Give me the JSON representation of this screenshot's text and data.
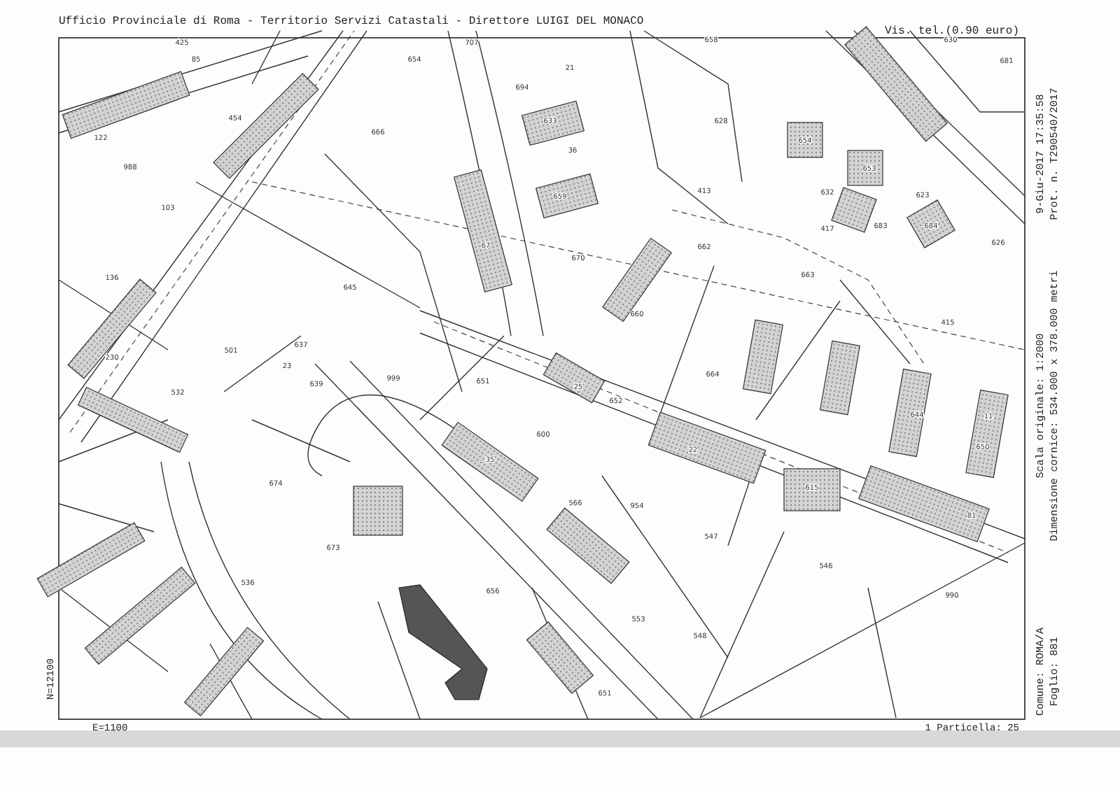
{
  "header": {
    "office": "Ufficio Provinciale di Roma - Territorio Servizi Catastali - Direttore LUIGI DEL MONACO",
    "fee": "Vis. tel.(0.90 euro)"
  },
  "side_info": [
    {
      "lines": [
        "9-Giu-2017 17:35:58",
        "Prot. n. T290540/2017"
      ]
    },
    {
      "lines": [
        "Scala originale: 1:2000",
        "Dimensione cornice: 534.000 x 378.000 metri"
      ]
    },
    {
      "lines": [
        "Comune: ROMA/A",
        "Foglio: 881"
      ]
    }
  ],
  "map": {
    "parcel_numbers": [
      "425",
      "85",
      "454",
      "122",
      "988",
      "103",
      "136",
      "230",
      "501",
      "532",
      "645",
      "666",
      "654",
      "707",
      "21",
      "694",
      "633",
      "36",
      "659",
      "67",
      "670",
      "637",
      "23",
      "639",
      "999",
      "651",
      "25",
      "652",
      "35",
      "600",
      "664",
      "22",
      "615",
      "81",
      "673",
      "674",
      "536",
      "566",
      "954",
      "547",
      "546",
      "656",
      "553",
      "548",
      "990",
      "651",
      "628",
      "654",
      "653",
      "632",
      "623",
      "683",
      "684",
      "626",
      "662",
      "663",
      "413",
      "417",
      "415",
      "630",
      "681",
      "658",
      "660",
      "11",
      "650",
      "644"
    ],
    "north_coordinate": "N=12100",
    "east_coordinate": "E=1100",
    "parcel_note": "1 Particella: 25"
  }
}
